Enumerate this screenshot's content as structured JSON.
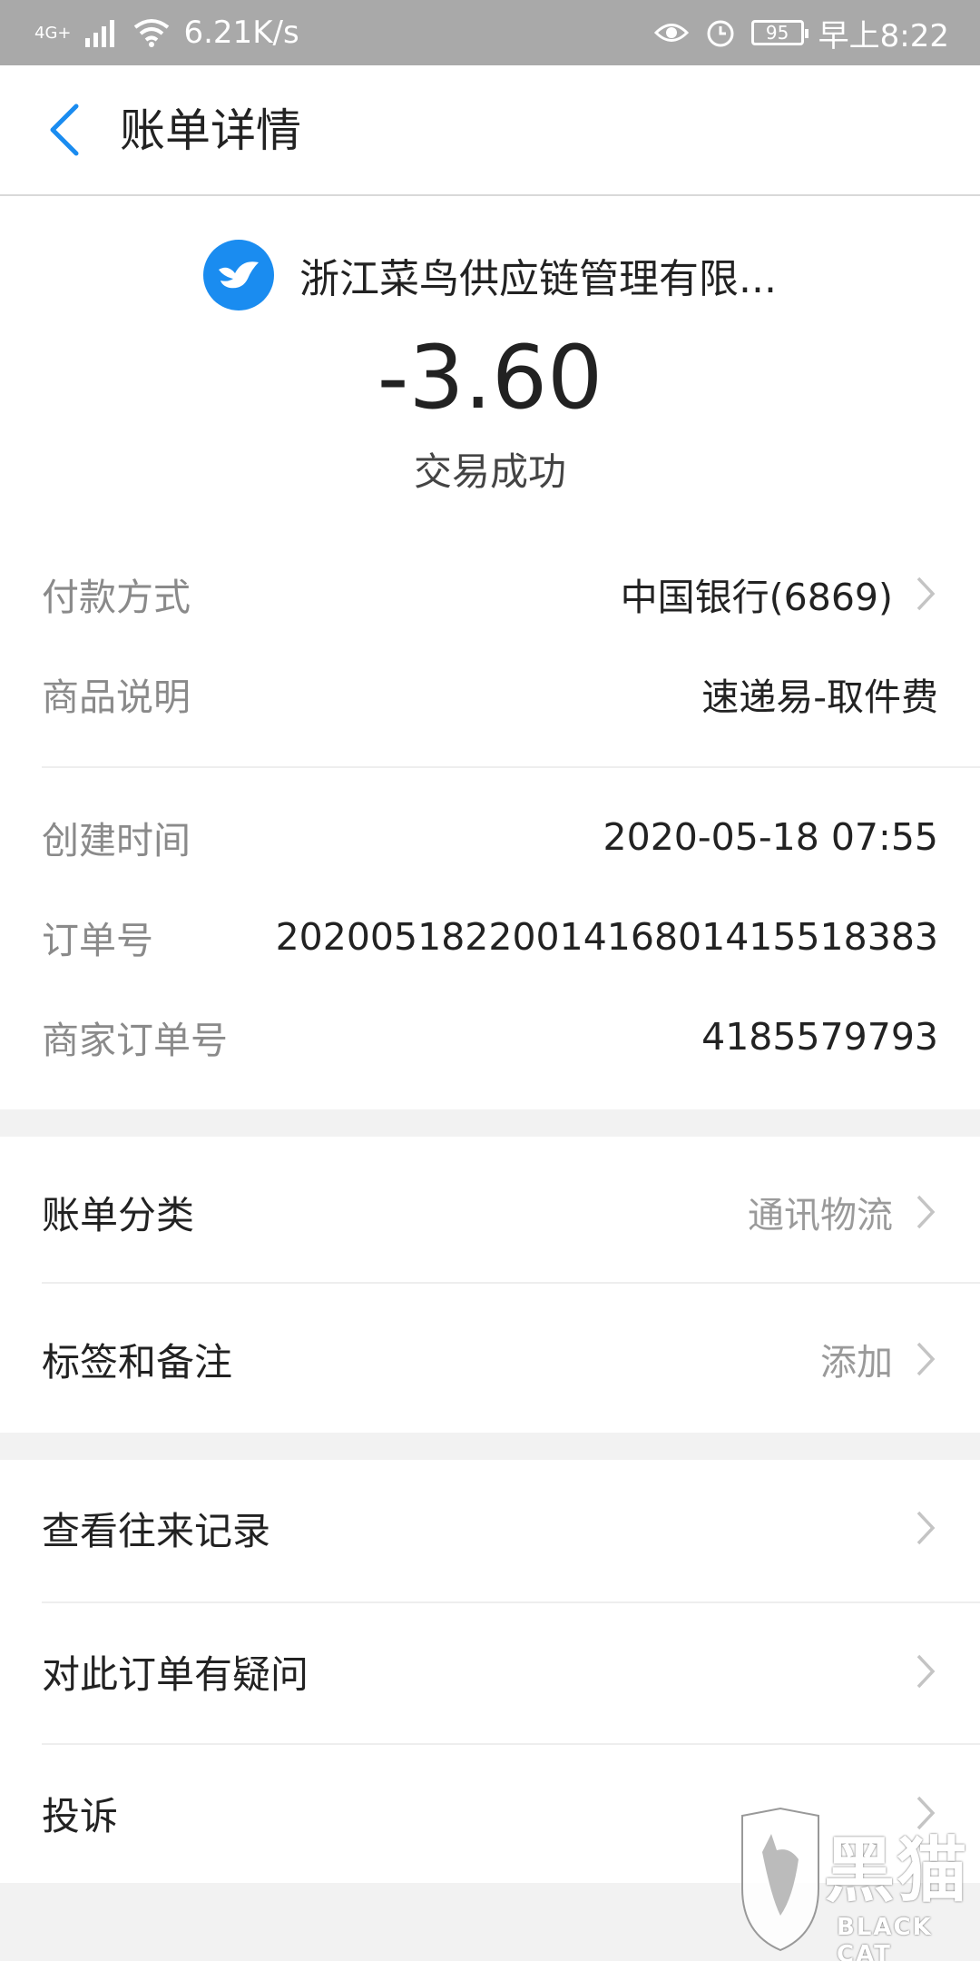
{
  "status_bar": {
    "network": "4G+",
    "speed": "6.21K/s",
    "battery": "95",
    "time": "早上8:22"
  },
  "header": {
    "title": "账单详情"
  },
  "summary": {
    "merchant": "浙江菜鸟供应链管理有限...",
    "amount": "-3.60",
    "status": "交易成功"
  },
  "details": {
    "payment_label": "付款方式",
    "payment_value": "中国银行(6869)",
    "item_label": "商品说明",
    "item_value": "速递易-取件费",
    "created_label": "创建时间",
    "created_value": "2020-05-18 07:55",
    "order_label": "订单号",
    "order_value": "2020051822001416801415518383",
    "merchant_order_label": "商家订单号",
    "merchant_order_value": "4185579793"
  },
  "category": {
    "label": "账单分类",
    "value": "通讯物流"
  },
  "tags": {
    "label": "标签和备注",
    "value": "添加"
  },
  "actions": {
    "history": "查看往来记录",
    "question": "对此订单有疑问",
    "complaint": "投诉"
  },
  "watermark": {
    "title": "黑猫",
    "subtitle": "BLACK CAT"
  }
}
